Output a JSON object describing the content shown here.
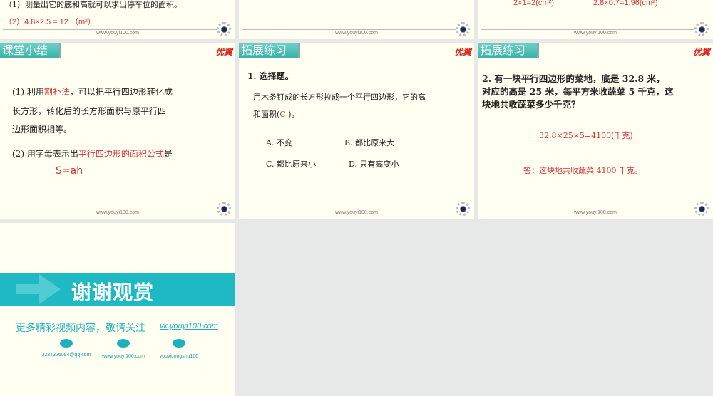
{
  "footer_url": "www.youyi100.com",
  "logo": "优翼",
  "top": {
    "s1_line1": "（1）测量出它的底和高就可以求出停车位的面积。",
    "s1_line2": "（2）4.8×2.5 = 12 （m²）",
    "s3_calc1": "2×1=2(cm²)",
    "s3_calc2": "2.8×0.7=1.96(cm²)"
  },
  "summary": {
    "title": "课堂小结",
    "p1_a": "(1) 利用",
    "p1_red": "割补法",
    "p1_b": "，可以把平行四边形转化成",
    "p1_line2": "长方形，转化后的长方形面积与原平行四",
    "p1_line3": "边形面积相等。",
    "p2_a": "(2) 用字母表示出",
    "p2_red": "平行四边形的面积公式",
    "p2_b": "是",
    "formula": "S=ah"
  },
  "ex1": {
    "title": "拓展练习",
    "q": "1.  选择题。",
    "stem1": "用木条钉成的长方形拉成一个平行四边形，它的高",
    "stem2a": "和面积(",
    "answer": "C",
    "stem2b": "     )。",
    "options": [
      "A. 不变",
      "B. 都比原来大",
      "C. 都比原来小",
      "D. 只有高变小"
    ]
  },
  "ex2": {
    "title": "拓展练习",
    "q1": "2.  有一块平行四边形的菜地，底是 32.8 米，",
    "q2": "对应的高是 25 米，每平方米收蔬菜 5 千克，这",
    "q3": "块地共收蔬菜多少千克？",
    "calc": "32.8×25×5=4100(千克)",
    "answer": "答：这块地共收蔬菜 4100 千克。"
  },
  "thanks": {
    "banner": "谢谢观赏",
    "follow": "更多精彩视频内容，敬请关注",
    "link": "vk.youyi100.com",
    "contacts": [
      {
        "icon": "email-icon",
        "text": "3334326094@qq.com"
      },
      {
        "icon": "web-icon",
        "text": "www.youyi100.com"
      },
      {
        "icon": "wechat-icon",
        "text": "youyicongshu100"
      }
    ]
  }
}
